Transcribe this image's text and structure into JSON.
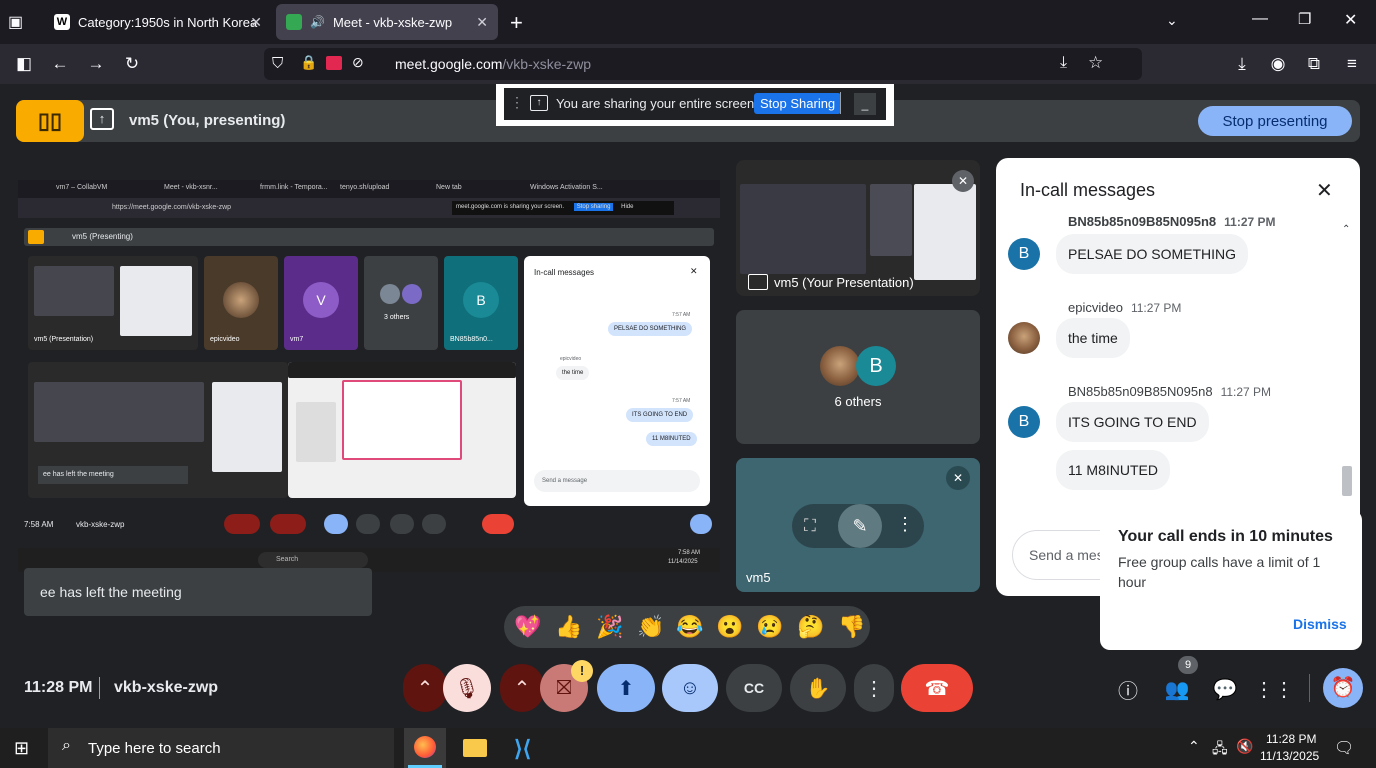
{
  "browser": {
    "tabs": [
      {
        "label": "Category:1950s in North Korea",
        "icon": "W"
      },
      {
        "label": "Meet - vkb-xske-zwp",
        "icon": "meet"
      }
    ],
    "new_tab": "+",
    "url_host": "meet.google.com",
    "url_path": "/vkb-xske-zwp"
  },
  "sharing": {
    "notice": "You are sharing your entire screen.",
    "stop_label": "Stop Sharing"
  },
  "presenting": {
    "label": "vm5 (You, presenting)",
    "stop_label": "Stop presenting"
  },
  "screen_share": {
    "mini_url": "https://meet.google.com/vkb-xske-zwp",
    "mini_tabs": [
      "vm7 – CollabVM",
      "Meet - vkb-xsnr...",
      "frmm.link - Tempora...",
      "tenyo.sh/upload",
      "New tab",
      "Windows Activation S..."
    ],
    "mini_notice": "meet.google.com is sharing your screen.",
    "mini_stop": "Stop sharing",
    "mini_hide": "Hide",
    "mini_presenting": "vm5 (Presenting)",
    "mini_tiles": [
      {
        "name": "vm5 (Presentation)"
      },
      {
        "name": "epicvideo"
      },
      {
        "name": "vm7",
        "initial": "V"
      },
      {
        "name": "3 others"
      },
      {
        "name": "BN85b85n0...",
        "initial": "B"
      }
    ],
    "mini_chat": {
      "title": "In-call messages",
      "messages": [
        {
          "time": "7:57 AM",
          "text": "PELSAE DO SOMETHING"
        },
        {
          "sender": "epicvideo",
          "time": "7:57 AM",
          "text": "the time"
        },
        {
          "time": "7:57 AM",
          "text": "ITS GOING TO END"
        },
        {
          "text": "11 M8INUTED"
        }
      ],
      "placeholder": "Send a message"
    },
    "mini_toast": "ee has left the meeting",
    "mini_clock": "7:58 AM",
    "mini_code": "vkb-xske-zwp",
    "mini_search": "Search",
    "mini_tray_time": "7:58 AM",
    "mini_tray_date": "11/14/2025"
  },
  "tiles": {
    "presentation": "vm5 (Your Presentation)",
    "others_label": "6 others",
    "others_initial": "B",
    "self_label": "vm5"
  },
  "chat": {
    "title": "In-call messages",
    "messages": [
      {
        "sender": "BN85b85n09B85N095n8",
        "time": "11:27 PM",
        "lines": [
          "PELSAE DO SOMETHING"
        ],
        "avatar": "B"
      },
      {
        "sender": "epicvideo",
        "time": "11:27 PM",
        "lines": [
          "the time"
        ],
        "avatar": "img"
      },
      {
        "sender": "BN85b85n09B85N095n8",
        "time": "11:27 PM",
        "lines": [
          "ITS GOING TO END",
          "11 M8INUTED"
        ],
        "avatar": "B"
      }
    ],
    "input_placeholder": "Send a message"
  },
  "toast_left": "ee has left the meeting",
  "call_end": {
    "title": "Your call ends in 10 minutes",
    "body": "Free group calls have a limit of 1 hour",
    "dismiss": "Dismiss"
  },
  "reactions": [
    "💖",
    "👍",
    "🎉",
    "👏",
    "😂",
    "😮",
    "😢",
    "🤔",
    "👎"
  ],
  "meeting": {
    "time": "11:28 PM",
    "code": "vkb-xske-zwp",
    "people_count": "9",
    "camera_warning": "!"
  },
  "taskbar": {
    "search_placeholder": "Type here to search",
    "time": "11:28 PM",
    "date": "11/13/2025"
  },
  "colors": {
    "meet_bg": "#202124",
    "tile_bg": "#3c4043",
    "accent_blue": "#8ab4f8",
    "end_call": "#ea4335",
    "mic_off": "#f9dedc"
  }
}
